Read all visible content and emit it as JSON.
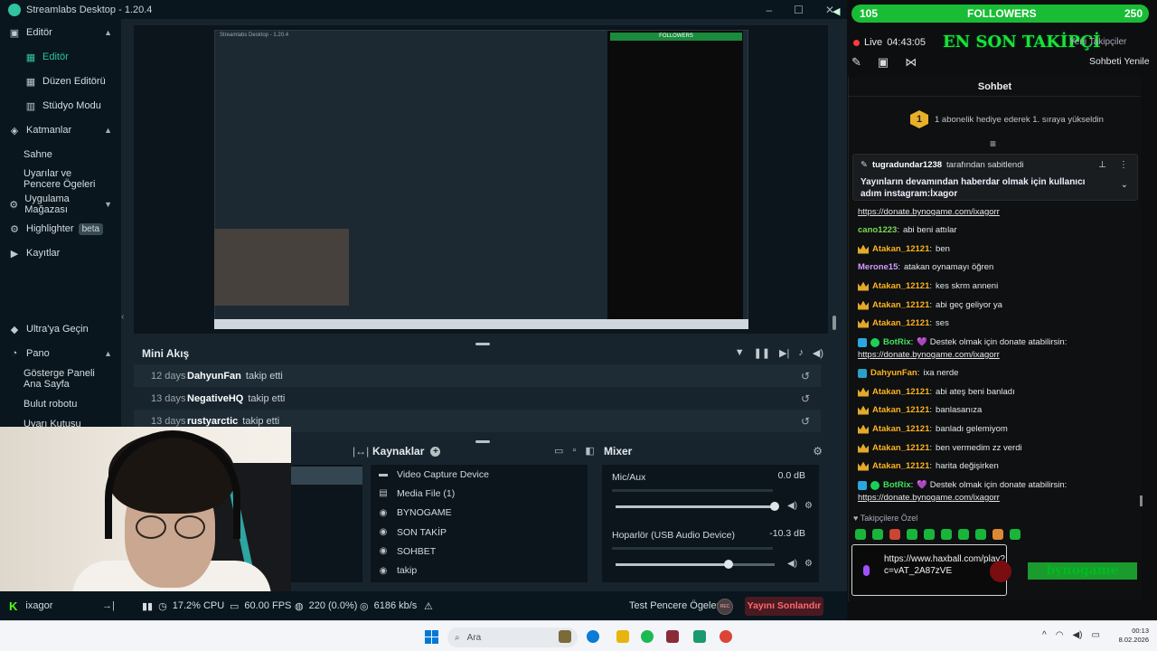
{
  "app": {
    "title": "Streamlabs Desktop - 1.20.4"
  },
  "sidebar": {
    "items": [
      {
        "label": "Editör",
        "icon": "editor-icon"
      },
      {
        "label": "Editör",
        "icon": "layout-icon"
      },
      {
        "label": "Düzen Editörü",
        "icon": "grid-icon"
      },
      {
        "label": "Stüdyo Modu",
        "icon": "studio-icon"
      },
      {
        "label": "Katmanlar",
        "icon": "layers-icon"
      },
      {
        "label": "Sahne"
      },
      {
        "label": "Uyarılar ve Pencere Ögeleri"
      },
      {
        "label": "Uygulama Mağazası",
        "icon": "store-icon"
      },
      {
        "label": "Highlighter",
        "badge": "beta",
        "icon": "highlighter-icon"
      },
      {
        "label": "Kayıtlar",
        "icon": "recordings-icon"
      },
      {
        "label": "Ultra'ya Geçin",
        "icon": "ultra-icon"
      },
      {
        "label": "Pano",
        "icon": "dashboard-icon"
      },
      {
        "label": "Gösterge Paneli Ana Sayfa"
      },
      {
        "label": "Bulut robotu"
      },
      {
        "label": "Uyarı Kutusu"
      }
    ]
  },
  "preview": {
    "embedded_title": "Streamlabs Desktop - 1.20.4",
    "embedded_followers": "FOLLOWERS"
  },
  "mini_akis": {
    "title": "Mini Akış",
    "events": [
      {
        "days": "12 days",
        "user": "DahyunFan",
        "action": "takip etti"
      },
      {
        "days": "13 days",
        "user": "NegativeHQ",
        "action": "takip etti"
      },
      {
        "days": "13 days",
        "user": "rustyarctic",
        "action": "takip etti"
      }
    ]
  },
  "sources": {
    "title": "Kaynaklar",
    "items": [
      {
        "label": "Video Capture Device",
        "icon": "camera-icon"
      },
      {
        "label": "Media File (1)",
        "icon": "file-icon"
      },
      {
        "label": "BYNOGAME",
        "icon": "globe-icon"
      },
      {
        "label": "SON TAKİP",
        "icon": "globe-icon"
      },
      {
        "label": "SOHBET",
        "icon": "globe-icon"
      },
      {
        "label": "takip",
        "icon": "globe-icon"
      }
    ]
  },
  "mixer": {
    "title": "Mixer",
    "channels": [
      {
        "name": "Mic/Aux",
        "db": "0.0 dB",
        "volume": 1.0,
        "level": 0.0
      },
      {
        "name": "Hoparlör (USB Audio Device)",
        "db": "-10.3 dB",
        "volume": 0.71,
        "level": 0.0
      }
    ]
  },
  "statusbar": {
    "user": "ixagor",
    "cpu": "17.2% CPU",
    "fps": "60.00 FPS",
    "dropped": "220 (0.0%)",
    "bitrate": "6186 kb/s",
    "test_label": "Test Pencere Ögeleri",
    "rec_label": "REC",
    "end_label": "Yayını Sonlandır"
  },
  "followers": {
    "min": "105",
    "label": "FOLLOWERS",
    "max": "250",
    "progress": 0.0
  },
  "live": {
    "label": "Live",
    "time": "04:43:05"
  },
  "last_follower": {
    "title": "EN SON TAKİPÇİ",
    "sub": "Yeni Takipçiler"
  },
  "chat": {
    "title": "Sohbet",
    "refresh": "Sohbeti Yenile",
    "gift_count": "1",
    "gift_text": "1 abonelik hediye ederek 1. sıraya yükseldin",
    "pinned_by": "tugradundar1238",
    "pinned_suffix": "tarafından sabitlendi",
    "pinned_text": "Yayınların devamından haberdar olmak için kullanıcı adım instagram:İxagor",
    "messages": [
      {
        "type": "link",
        "text": "https://donate.bynogame.com/ixagorr"
      },
      {
        "user": "cano1223",
        "color": "#7ed957",
        "badge": "none",
        "text": "abi beni attılar"
      },
      {
        "user": "Atakan_12121",
        "color": "#ffb21e",
        "badge": "crown",
        "text": "ben"
      },
      {
        "user": "Merone15",
        "color": "#d59cff",
        "badge": "none",
        "text": "atakan oynamayı öğren"
      },
      {
        "user": "Atakan_12121",
        "color": "#ffb21e",
        "badge": "crown",
        "text": "kes skrm anneni"
      },
      {
        "user": "Atakan_12121",
        "color": "#ffb21e",
        "badge": "crown",
        "text": "abi geç geliyor ya"
      },
      {
        "user": "Atakan_12121",
        "color": "#ffb21e",
        "badge": "crown",
        "text": "ses"
      },
      {
        "user": "BotRix",
        "color": "#3ee35d",
        "badge": "bot",
        "text": "💜 Destek olmak için donate atabilirsin:"
      },
      {
        "type": "link",
        "text": "https://donate.bynogame.com/ixagorr"
      },
      {
        "user": "DahyunFan",
        "color": "#ffb21e",
        "badge": "sub",
        "text": "ixa nerde"
      },
      {
        "user": "Atakan_12121",
        "color": "#ffb21e",
        "badge": "crown",
        "text": "abi ateş beni banladı"
      },
      {
        "user": "Atakan_12121",
        "color": "#ffb21e",
        "badge": "crown",
        "text": "banlasanıza"
      },
      {
        "user": "Atakan_12121",
        "color": "#ffb21e",
        "badge": "crown",
        "text": "banladı gelemiyom"
      },
      {
        "user": "Atakan_12121",
        "color": "#ffb21e",
        "badge": "crown",
        "text": "ben vermedim zz verdi"
      },
      {
        "user": "Atakan_12121",
        "color": "#ffb21e",
        "badge": "crown",
        "text": "harita değişirken"
      },
      {
        "user": "BotRix",
        "color": "#3ee35d",
        "badge": "bot",
        "text": "💜 Destek olmak için donate atabilirsin:"
      },
      {
        "type": "link",
        "text": "https://donate.bynogame.com/ixagorr"
      }
    ],
    "followers_only": "Takipçilere Özel",
    "input_value": "https://www.haxball.com/play?c=vAT_2A87zVE",
    "kick_badge": "bynogame"
  },
  "taskbar": {
    "search": "Ara",
    "time": "00:13",
    "date": "8.02.2026"
  },
  "colors": {
    "accent": "#31c3a2",
    "follow_bar": "#18bd35",
    "end_stream": "#ff6871",
    "kick": "#53fc18"
  }
}
